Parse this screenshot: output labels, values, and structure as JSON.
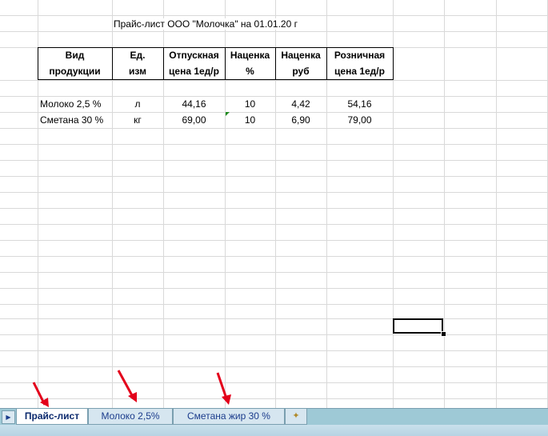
{
  "sheet": {
    "title": "Прайс-лист ООО \"Молочка\" на 01.01.20 г",
    "headers": [
      {
        "line1": "Вид",
        "line2": "продукции"
      },
      {
        "line1": "Ед.",
        "line2": "изм"
      },
      {
        "line1": "Отпускная",
        "line2": "цена 1ед/р"
      },
      {
        "line1": "Наценка",
        "line2": "%"
      },
      {
        "line1": "Наценка",
        "line2": "руб"
      },
      {
        "line1": "Розничная",
        "line2": "цена 1ед/р"
      }
    ],
    "rows": [
      {
        "product": "Молоко 2,5 %",
        "unit": "л",
        "price": "44,16",
        "markup_pct": "10",
        "markup_rub": "4,42",
        "retail": "54,16"
      },
      {
        "product": "Сметана 30 %",
        "unit": "кг",
        "price": "69,00",
        "markup_pct": "10",
        "markup_rub": "6,90",
        "retail": "79,00"
      }
    ]
  },
  "tabs": [
    {
      "label": "Прайс-лист",
      "active": true
    },
    {
      "label": "Молоко 2,5%",
      "active": false
    },
    {
      "label": "Сметана жир 30 %",
      "active": false
    }
  ],
  "colors": {
    "arrow": "#e3001b",
    "tab_bar": "#9ec9d6",
    "grid": "#d9d9d9"
  },
  "icons": {
    "nav": "scroll-right-icon",
    "new_sheet": "insert-sheet-icon"
  }
}
